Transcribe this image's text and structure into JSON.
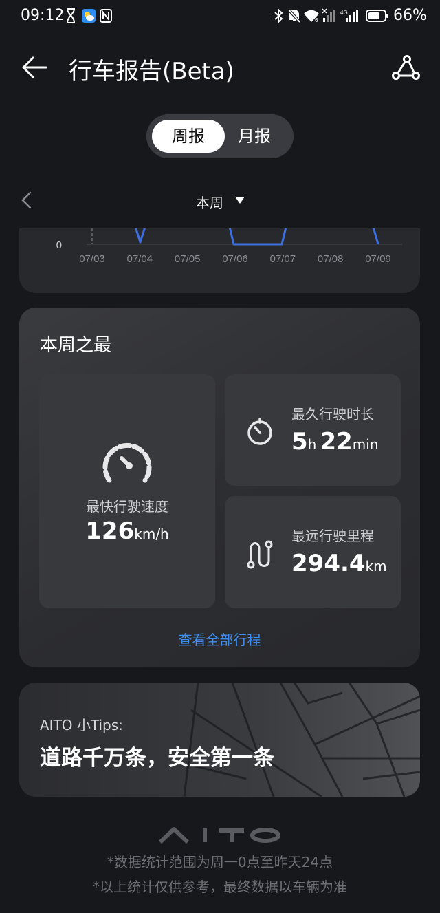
{
  "status_bar": {
    "time": "09:12",
    "battery": "66%",
    "icons": [
      "hourglass-icon",
      "weather-icon",
      "nfc-icon",
      "bluetooth-icon",
      "bell-off-icon",
      "wifi-icon",
      "signal-icon",
      "battery-icon"
    ]
  },
  "header": {
    "title": "行车报告(Beta)",
    "back_icon": "arrow-left-icon",
    "share_icon": "share-icon"
  },
  "segment": {
    "tabs": [
      {
        "label": "周报",
        "active": true
      },
      {
        "label": "月报",
        "active": false
      }
    ]
  },
  "period": {
    "label": "本周"
  },
  "chart_data": {
    "type": "line",
    "categories": [
      "07/03",
      "07/04",
      "07/05",
      "07/06",
      "07/07",
      "07/08",
      "07/09"
    ],
    "y_tick_labels": [
      "0"
    ],
    "colors": {
      "line": "#3d6fe0",
      "grid": "#4a4b50",
      "label": "#8a8b90"
    }
  },
  "best": {
    "title": "本周之最",
    "speed": {
      "label": "最快行驶速度",
      "value": "126",
      "unit": "km/h"
    },
    "duration": {
      "label": "最久行驶时长",
      "hours": "5",
      "hours_unit": "h",
      "minutes": "22",
      "minutes_unit": "min"
    },
    "distance": {
      "label": "最远行驶里程",
      "value": "294.4",
      "unit": "km"
    },
    "view_all": "查看全部行程"
  },
  "tips": {
    "caption": "AITO 小Tips:",
    "text": "道路千万条，安全第一条"
  },
  "footer": {
    "brand": "AITO",
    "note_1": "*数据统计范围为周一0点至昨天24点",
    "note_2": "*以上统计仅供参考，最终数据以车辆为准"
  },
  "colors": {
    "background": "#17181c",
    "card": "#28292d",
    "accent_link": "#3d8ff5"
  }
}
